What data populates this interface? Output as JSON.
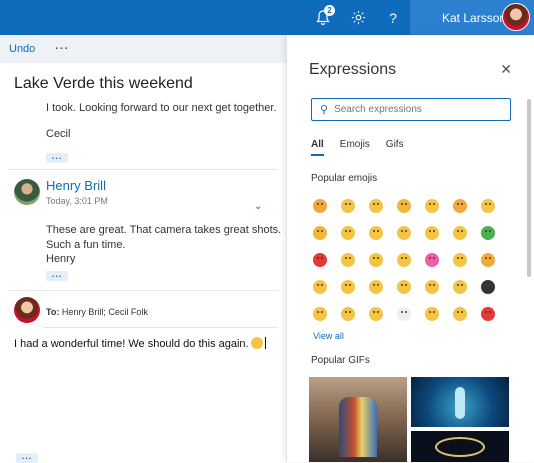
{
  "topbar": {
    "notification_count": "2",
    "user_name": "Kat Larsson",
    "icons": [
      "bell-icon",
      "gear-icon",
      "help-icon"
    ]
  },
  "commandbar": {
    "undo_label": "Undo",
    "more_label": "···"
  },
  "thread": {
    "subject": "Lake Verde this weekend",
    "message1": {
      "line1": "I took. Looking forward to our next get together.",
      "signature": "Cecil"
    },
    "message2": {
      "sender": "Henry Brill",
      "date": "Today, 3:01 PM",
      "line1": "These are great. That camera takes great shots.",
      "line2": "Such a fun time.",
      "signature": "Henry"
    },
    "reply": {
      "to_label": "To:",
      "recipients": "Henry Brill; Cecil Folk",
      "body": "I had a wonderful time!  We should do this again."
    }
  },
  "expressions": {
    "title": "Expressions",
    "search_placeholder": "Search expressions",
    "tabs": [
      {
        "label": "All"
      },
      {
        "label": "Emojis"
      },
      {
        "label": "Gifs"
      }
    ],
    "active_tab": "All",
    "popular_emojis_label": "Popular emojis",
    "emojis": [
      "#f2a93b",
      "#f2c44a",
      "#f6c445",
      "#f0b83a",
      "#f6c445",
      "#f2a93b",
      "#f6c445",
      "#f0b83a",
      "#f6c445",
      "#f6c445",
      "#f6c445",
      "#f6c445",
      "#f6c445",
      "#4caf50",
      "#e53935",
      "#f6c445",
      "#f6c445",
      "#f6c445",
      "#ec5fa8",
      "#f6c445",
      "#f2a93b",
      "#f6c445",
      "#f6c445",
      "#f6c445",
      "#f6c445",
      "#f6c445",
      "#f2c44a",
      "#333333",
      "#f6c445",
      "#f6c445",
      "#f6c445",
      "#eeeeee",
      "#f6c445",
      "#f6c445",
      "#e53935"
    ],
    "view_all_label": "View all",
    "popular_gifs_label": "Popular GIFs"
  }
}
